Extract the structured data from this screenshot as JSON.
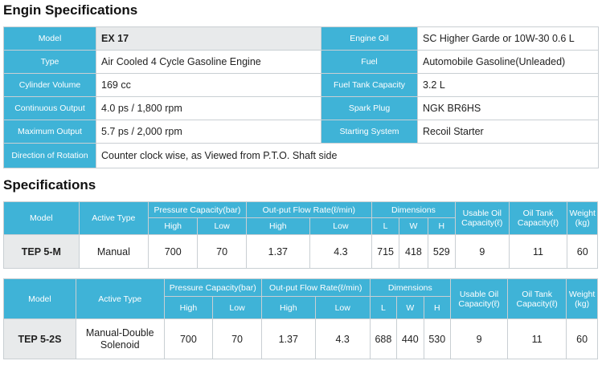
{
  "engine": {
    "title": "Engin Specifications",
    "rows": [
      {
        "l1": "Model",
        "v1": "EX 17",
        "l2": "Engine Oil",
        "v2": "SC Higher Garde or 10W-30 0.6 L"
      },
      {
        "l1": "Type",
        "v1": "Air Cooled 4 Cycle Gasoline Engine",
        "l2": "Fuel",
        "v2": "Automobile Gasoline(Unleaded)"
      },
      {
        "l1": "Cylinder Volume",
        "v1": "169 cc",
        "l2": "Fuel Tank Capacity",
        "v2": "3.2 L"
      },
      {
        "l1": "Continuous Output",
        "v1": "4.0 ps / 1,800 rpm",
        "l2": "Spark Plug",
        "v2": "NGK BR6HS"
      },
      {
        "l1": "Maximum Output",
        "v1": "5.7 ps / 2,000 rpm",
        "l2": "Starting System",
        "v2": "Recoil Starter"
      }
    ],
    "rotation": {
      "label": "Direction of Rotation",
      "value": "Counter clock wise, as Viewed from P.T.O. Shaft side"
    }
  },
  "specs": {
    "title": "Specifications",
    "headers": {
      "model": "Model",
      "active_type": "Active Type",
      "pressure": "Pressure Capacity(bar)",
      "flow": "Out-put Flow Rate(ℓ/min)",
      "dimensions": "Dimensions",
      "usable_oil": "Usable Oil Capacity(ℓ)",
      "oil_tank": "Oil Tank Capacity(ℓ)",
      "weight": "Weight (kg)",
      "high": "High",
      "low": "Low",
      "l": "L",
      "w": "W",
      "h": "H"
    },
    "tables": [
      {
        "model": "TEP 5-M",
        "type": "Manual",
        "p_high": "700",
        "p_low": "70",
        "f_high": "1.37",
        "f_low": "4.3",
        "l": "715",
        "w": "418",
        "h": "529",
        "usable": "9",
        "tank": "11",
        "weight": "60"
      },
      {
        "model": "TEP 5-2S",
        "type": "Manual-Double Solenoid",
        "p_high": "700",
        "p_low": "70",
        "f_high": "1.37",
        "f_low": "4.3",
        "l": "688",
        "w": "440",
        "h": "530",
        "usable": "9",
        "tank": "11",
        "weight": "60"
      }
    ]
  }
}
